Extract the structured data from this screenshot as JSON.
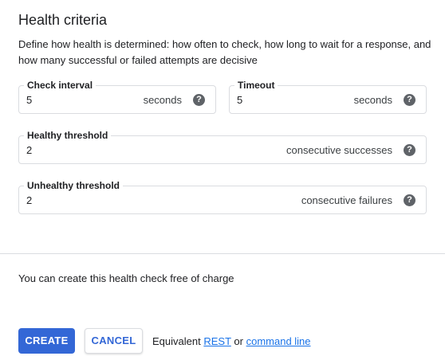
{
  "section": {
    "title": "Health criteria",
    "description": "Define how health is determined: how often to check, how long to wait for a response, and how many successful or failed attempts are decisive"
  },
  "fields": {
    "check_interval": {
      "label": "Check interval",
      "value": "5",
      "suffix": "seconds"
    },
    "timeout": {
      "label": "Timeout",
      "value": "5",
      "suffix": "seconds"
    },
    "healthy_threshold": {
      "label": "Healthy threshold",
      "value": "2",
      "suffix": "consecutive successes"
    },
    "unhealthy_threshold": {
      "label": "Unhealthy threshold",
      "value": "2",
      "suffix": "consecutive failures"
    }
  },
  "help_icon_glyph": "?",
  "pricing_note": "You can create this health check free of charge",
  "footer": {
    "create_label": "CREATE",
    "cancel_label": "CANCEL",
    "equivalent_text": "Equivalent",
    "rest_link": "REST",
    "or_text": "or",
    "command_line_link": "command line"
  },
  "colors": {
    "primary": "#3367d6",
    "link": "#1a73e8",
    "border": "#dadce0",
    "icon": "#5f6368"
  }
}
